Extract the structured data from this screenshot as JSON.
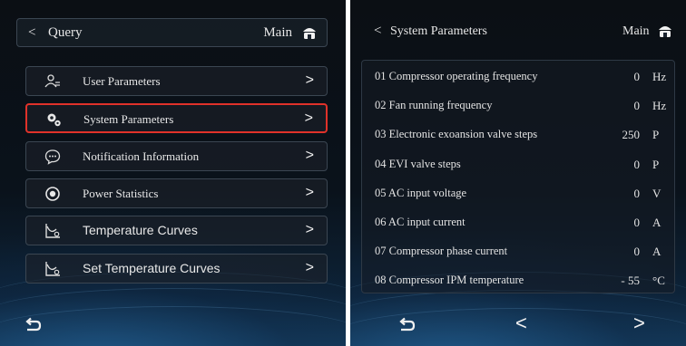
{
  "left": {
    "header": {
      "back_glyph": "<",
      "title": "Query",
      "main_label": "Main",
      "home_icon": "home-icon"
    },
    "menu": [
      {
        "label": "User Parameters",
        "icon": "users-icon",
        "chevron": ">",
        "selected": false
      },
      {
        "label": "System Parameters",
        "icon": "gears-icon",
        "chevron": ">",
        "selected": true
      },
      {
        "label": "Notification Information",
        "icon": "message-icon",
        "chevron": ">",
        "selected": false
      },
      {
        "label": "Power Statistics",
        "icon": "power-icon",
        "chevron": ">",
        "selected": false
      },
      {
        "label": "Temperature Curves",
        "icon": "curve-icon",
        "chevron": ">",
        "selected": false
      },
      {
        "label": "Set Temperature Curves",
        "icon": "curve-icon",
        "chevron": ">",
        "selected": false
      }
    ],
    "footer": {
      "back_icon": "return-icon"
    }
  },
  "right": {
    "header": {
      "back_glyph": "<",
      "title": "System Parameters",
      "main_label": "Main",
      "home_icon": "home-icon"
    },
    "params": [
      {
        "label": "01 Compressor operating frequency",
        "value": "0",
        "unit": "Hz"
      },
      {
        "label": "02 Fan running frequency",
        "value": "0",
        "unit": "Hz"
      },
      {
        "label": "03 Electronic exoansion valve steps",
        "value": "250",
        "unit": "P"
      },
      {
        "label": "04 EVI valve steps",
        "value": "0",
        "unit": "P"
      },
      {
        "label": "05 AC input voltage",
        "value": "0",
        "unit": "V"
      },
      {
        "label": "06 AC input current",
        "value": "0",
        "unit": "A"
      },
      {
        "label": "07 Compressor phase current",
        "value": "0",
        "unit": "A"
      },
      {
        "label": "08 Compressor IPM temperature",
        "value": "- 55",
        "unit": "°C"
      }
    ],
    "footer": {
      "back_icon": "return-icon",
      "prev_glyph": "<",
      "next_glyph": ">"
    }
  },
  "colors": {
    "selected_border": "#e0322a",
    "background": "#0a121b",
    "text": "#e6e6e6"
  }
}
